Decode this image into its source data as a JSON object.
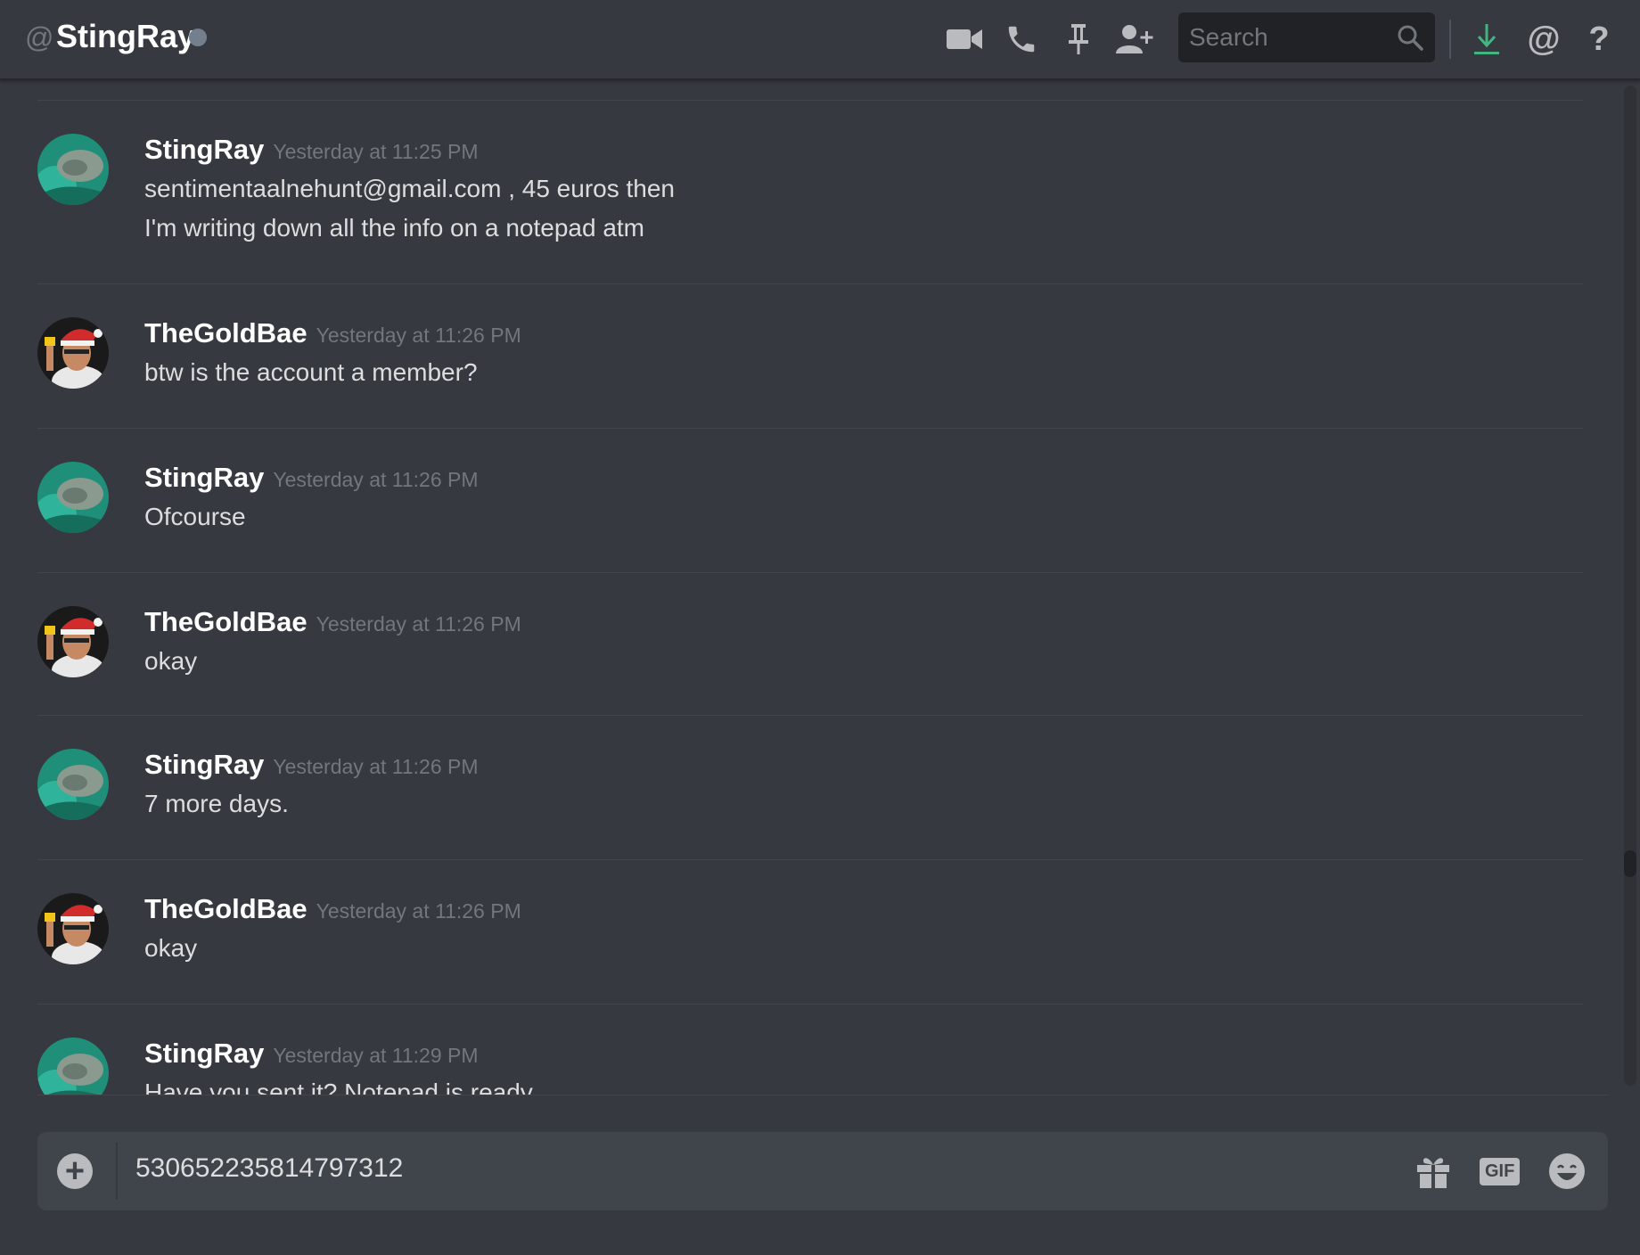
{
  "header": {
    "at_symbol": "@",
    "channel_name": "StingRay",
    "search_placeholder": "Search",
    "icons": [
      "video-call-icon",
      "voice-call-icon",
      "pin-icon",
      "add-friend-icon",
      "search-icon",
      "download-icon",
      "mentions-icon",
      "help-icon"
    ]
  },
  "messages": [
    {
      "author": "StingRay",
      "timestamp": "Yesterday at 11:25 PM",
      "lines": [
        "sentimentaalnehunt@gmail.com , 45 euros then",
        "I'm writing down all the info on a notepad atm"
      ]
    },
    {
      "author": "TheGoldBae",
      "timestamp": "Yesterday at 11:26 PM",
      "lines": [
        "btw is the account a member?"
      ]
    },
    {
      "author": "StingRay",
      "timestamp": "Yesterday at 11:26 PM",
      "lines": [
        "Ofcourse"
      ]
    },
    {
      "author": "TheGoldBae",
      "timestamp": "Yesterday at 11:26 PM",
      "lines": [
        "okay"
      ]
    },
    {
      "author": "StingRay",
      "timestamp": "Yesterday at 11:26 PM",
      "lines": [
        "7 more days."
      ]
    },
    {
      "author": "TheGoldBae",
      "timestamp": "Yesterday at 11:26 PM",
      "lines": [
        "okay"
      ]
    },
    {
      "author": "StingRay",
      "timestamp": "Yesterday at 11:29 PM",
      "lines": [
        "Have you sent it? Notepad is ready"
      ]
    }
  ],
  "composer": {
    "value": "530652235814797312",
    "icons": [
      "add-attachment-icon",
      "gift-icon",
      "gif-icon",
      "emoji-icon"
    ],
    "gif_label": "GIF"
  },
  "colors": {
    "background": "#36393f",
    "composer_bg": "#40444b",
    "download_accent": "#43b581",
    "status_idle": "#747f8d"
  }
}
